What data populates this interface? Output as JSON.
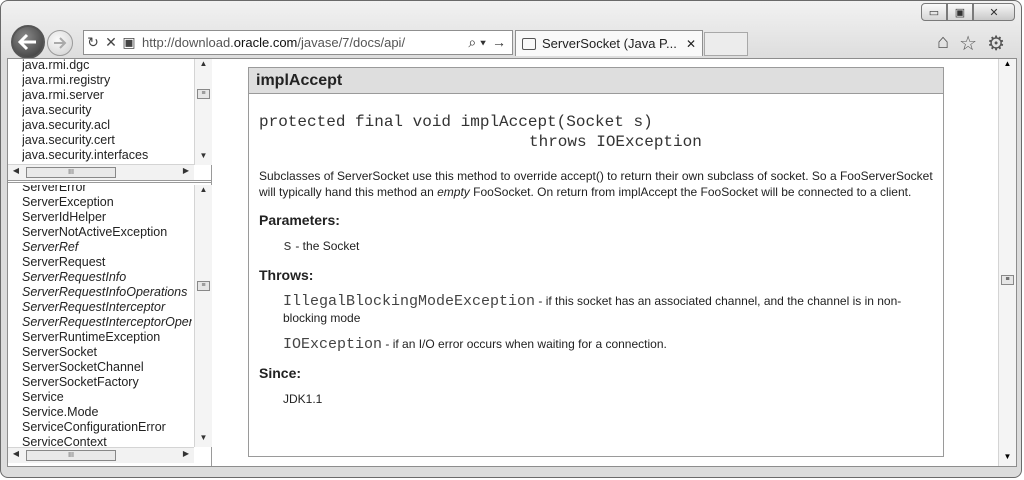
{
  "window": {
    "min_label": "▭",
    "max_label": "▣",
    "close_label": "✕"
  },
  "toolbar": {
    "url_prefix": "http://download.",
    "url_domain": "oracle.com",
    "url_suffix": "/javase/7/docs/api/",
    "search_glyph": "⌕ ▾",
    "go_glyph": "→",
    "refresh_glyph": "↻",
    "stop_glyph": "✕",
    "tab_title": "ServerSocket (Java P...",
    "tab_close": "✕",
    "home_glyph": "⌂",
    "fav_glyph": "☆",
    "tools_glyph": "⚙"
  },
  "packages": [
    "java.rmi.dgc",
    "java.rmi.registry",
    "java.rmi.server",
    "java.security",
    "java.security.acl",
    "java.security.cert",
    "java.security.interfaces"
  ],
  "classes": [
    {
      "name": "ServerError",
      "italic": false
    },
    {
      "name": "ServerException",
      "italic": false
    },
    {
      "name": "ServerIdHelper",
      "italic": false
    },
    {
      "name": "ServerNotActiveException",
      "italic": false
    },
    {
      "name": "ServerRef",
      "italic": true
    },
    {
      "name": "ServerRequest",
      "italic": false
    },
    {
      "name": "ServerRequestInfo",
      "italic": true
    },
    {
      "name": "ServerRequestInfoOperations",
      "italic": true
    },
    {
      "name": "ServerRequestInterceptor",
      "italic": true
    },
    {
      "name": "ServerRequestInterceptorOperations",
      "italic": true
    },
    {
      "name": "ServerRuntimeException",
      "italic": false
    },
    {
      "name": "ServerSocket",
      "italic": false
    },
    {
      "name": "ServerSocketChannel",
      "italic": false
    },
    {
      "name": "ServerSocketFactory",
      "italic": false
    },
    {
      "name": "Service",
      "italic": false
    },
    {
      "name": "Service.Mode",
      "italic": false
    },
    {
      "name": "ServiceConfigurationError",
      "italic": false
    },
    {
      "name": "ServiceContext",
      "italic": false
    }
  ],
  "scroll": {
    "up": "▲",
    "down": "▼",
    "left": "◀",
    "right": "▶",
    "grip": "≡",
    "hgrip": "III"
  },
  "detail": {
    "heading": "implAccept",
    "sig_line1": "protected final void implAccept(Socket s)",
    "sig_line2": "throws IOException",
    "desc_a": "Subclasses of ServerSocket use this method to override accept() to return their own subclass of socket. So a FooServerSocket will typically hand this method an ",
    "desc_em": "empty",
    "desc_b": " FooSocket. On return from implAccept the FooSocket will be connected to a client.",
    "params_heading": "Parameters:",
    "param_code": "s",
    "param_text": " - the Socket",
    "throws_heading": "Throws:",
    "throw1_code": "IllegalBlockingModeException",
    "throw1_text": " - if this socket has an associated channel, and the channel is in non-blocking mode",
    "throw2_code": "IOException",
    "throw2_text": " - if an I/O error occurs when waiting for a connection.",
    "since_heading": "Since:",
    "since_value": "JDK1.1"
  }
}
